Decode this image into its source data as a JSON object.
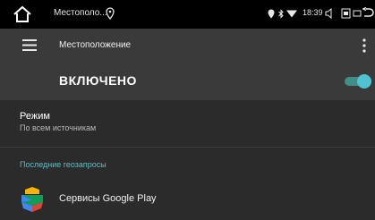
{
  "status_bar": {
    "app_title": "Местополо...",
    "time": "18:39",
    "icons": [
      "home-icon",
      "location-pin-icon",
      "location-icon",
      "bluetooth-icon",
      "wifi-icon",
      "volume-icon",
      "screenshot-icon",
      "window-icon",
      "back-icon"
    ]
  },
  "toolbar": {
    "title": "Местоположение",
    "menu_icon": "hamburger-menu-icon",
    "overflow_icon": "more-vert-icon"
  },
  "master_switch": {
    "label": "ВКЛЮЧЕНО",
    "state": "on"
  },
  "mode": {
    "title": "Режим",
    "value": "По всем источникам"
  },
  "recent_requests": {
    "header": "Последние геозапросы",
    "items": [
      {
        "name": "Сервисы Google Play",
        "icon": "google-play-services-icon"
      }
    ]
  },
  "colors": {
    "accent": "#5bbfc6",
    "switch_thumb": "#4fc3d0",
    "background": "#2b2b2b",
    "toolbar": "#3a3a3a"
  }
}
